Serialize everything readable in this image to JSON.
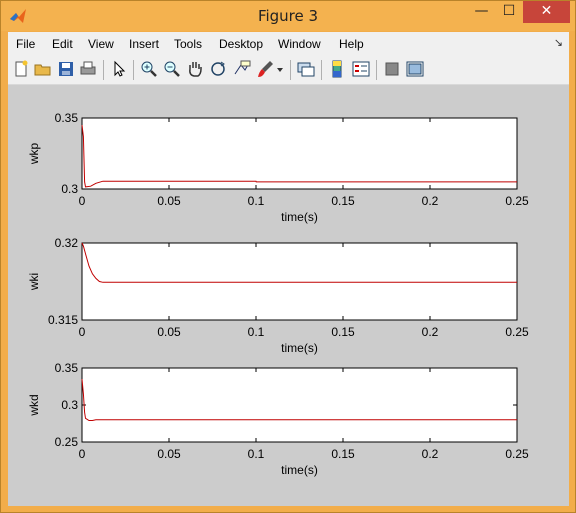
{
  "window": {
    "title": "Figure 3"
  },
  "window_controls": {
    "minimize": "—",
    "maximize": "☐",
    "close": "✕"
  },
  "menu": [
    "File",
    "Edit",
    "View",
    "Insert",
    "Tools",
    "Desktop",
    "Window",
    "Help"
  ],
  "toolbar_icons": [
    "new-figure-icon",
    "open-file-icon",
    "save-icon",
    "print-icon",
    "pointer-icon",
    "zoom-in-icon",
    "zoom-out-icon",
    "pan-hand-icon",
    "rotate-3d-icon",
    "data-cursor-icon",
    "brush-icon",
    "brush-dropdown-icon",
    "link-plot-icon",
    "colorbar-icon",
    "legend-icon",
    "hide-plot-tools-icon",
    "show-plot-tools-icon"
  ],
  "colors": {
    "line": "#c00000",
    "axes_bg": "#ffffff",
    "figure_bg": "#cccccc"
  },
  "chart_data": [
    {
      "type": "line",
      "xlabel": "time(s)",
      "ylabel": "wkp",
      "xlim": [
        0,
        0.25
      ],
      "ylim": [
        0.3,
        0.35
      ],
      "xticks": [
        "0",
        "0.05",
        "0.1",
        "0.15",
        "0.2",
        "0.25"
      ],
      "yticks": [
        "0.3",
        "0.35"
      ],
      "series": [
        {
          "x": [
            0,
            0.0008,
            0.0015,
            0.002,
            0.005,
            0.008,
            0.012,
            0.05,
            0.1,
            0.1001,
            0.15,
            0.2,
            0.25
          ],
          "y": [
            0.345,
            0.337,
            0.305,
            0.3015,
            0.302,
            0.304,
            0.3055,
            0.3055,
            0.3055,
            0.305,
            0.305,
            0.305,
            0.305
          ]
        }
      ]
    },
    {
      "type": "line",
      "xlabel": "time(s)",
      "ylabel": "wki",
      "xlim": [
        0,
        0.25
      ],
      "ylim": [
        0.315,
        0.32
      ],
      "xticks": [
        "0",
        "0.05",
        "0.1",
        "0.15",
        "0.2",
        "0.25"
      ],
      "yticks": [
        "0.315",
        "0.32"
      ],
      "series": [
        {
          "x": [
            0,
            0.0008,
            0.002,
            0.004,
            0.006,
            0.008,
            0.01,
            0.012,
            0.015,
            0.05,
            0.1,
            0.15,
            0.2,
            0.25
          ],
          "y": [
            0.32,
            0.3198,
            0.3193,
            0.3185,
            0.318,
            0.3177,
            0.3175,
            0.31745,
            0.31745,
            0.31745,
            0.31745,
            0.31745,
            0.31745,
            0.31745
          ]
        }
      ]
    },
    {
      "type": "line",
      "xlabel": "time(s)",
      "ylabel": "wkd",
      "xlim": [
        0,
        0.25
      ],
      "ylim": [
        0.25,
        0.35
      ],
      "xticks": [
        "0",
        "0.05",
        "0.1",
        "0.15",
        "0.2",
        "0.25"
      ],
      "yticks": [
        "0.25",
        "0.3",
        "0.35"
      ],
      "series": [
        {
          "x": [
            0,
            0.0008,
            0.0015,
            0.002,
            0.004,
            0.006,
            0.008,
            0.05,
            0.1,
            0.15,
            0.2,
            0.25
          ],
          "y": [
            0.335,
            0.315,
            0.29,
            0.282,
            0.279,
            0.279,
            0.28,
            0.28,
            0.28,
            0.28,
            0.28,
            0.28
          ]
        }
      ]
    }
  ]
}
